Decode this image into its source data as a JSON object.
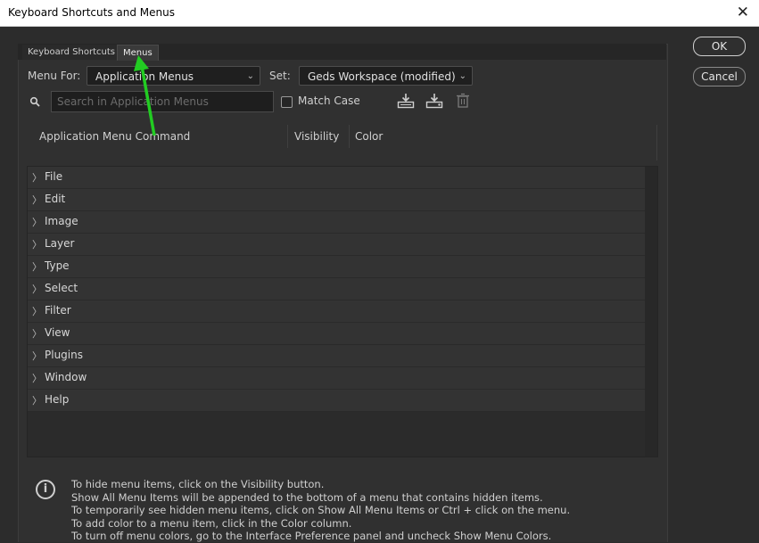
{
  "window": {
    "title": "Keyboard Shortcuts and Menus"
  },
  "tabs": [
    "Keyboard Shortcuts",
    "Menus"
  ],
  "controls": {
    "menu_for_label": "Menu For:",
    "menu_for_value": "Application Menus",
    "set_label": "Set:",
    "set_value": "Geds Workspace (modified)",
    "search_placeholder": "Search in Application Menus",
    "match_case_label": "Match Case"
  },
  "columns": [
    "Application Menu Command",
    "Visibility",
    "Color"
  ],
  "menus": [
    "File",
    "Edit",
    "Image",
    "Layer",
    "Type",
    "Select",
    "Filter",
    "View",
    "Plugins",
    "Window",
    "Help"
  ],
  "info_lines": [
    "To hide menu items, click on the Visibility button.",
    "Show All Menu Items will be appended to the bottom of a menu that contains hidden items.",
    "To temporarily see hidden menu items, click on Show All Menu Items or Ctrl + click on the menu.",
    "To add color to a menu item, click in the Color column.",
    "To turn off menu colors, go to the Interface Preference panel and uncheck Show Menu Colors."
  ],
  "buttons": {
    "ok": "OK",
    "cancel": "Cancel"
  },
  "icons": [
    "search-icon",
    "save-set-icon",
    "save-set-as-icon",
    "delete-set-icon",
    "info-icon",
    "close-icon"
  ],
  "colors": {
    "annotation_arrow": "#22cc22",
    "background": "#2c2c2c"
  }
}
